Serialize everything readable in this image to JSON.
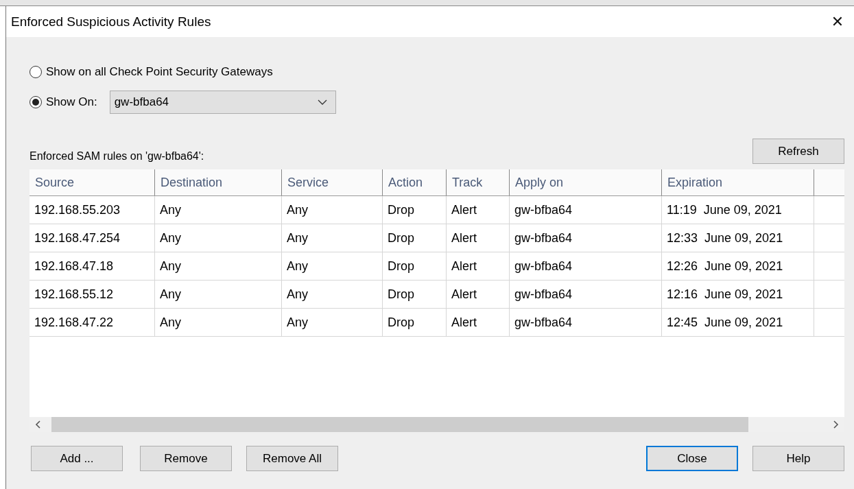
{
  "window": {
    "title": "Enforced Suspicious Activity Rules",
    "close": "✕"
  },
  "scope": [
    {
      "label": "Show on all Check Point Security Gateways",
      "selected": false
    },
    {
      "label": "Show On:",
      "selected": true
    }
  ],
  "gateway_select": {
    "value": "gw-bfba64"
  },
  "rules_label": "Enforced SAM rules on 'gw-bfba64':",
  "refresh_button": "Refresh",
  "table": {
    "columns": [
      "Source",
      "Destination",
      "Service",
      "Action",
      "Track",
      "Apply on",
      "Expiration"
    ],
    "rows": [
      [
        "192.168.55.203",
        "Any",
        "Any",
        "Drop",
        "Alert",
        "gw-bfba64",
        "11:19  June 09, 2021"
      ],
      [
        "192.168.47.254",
        "Any",
        "Any",
        "Drop",
        "Alert",
        "gw-bfba64",
        "12:33  June 09, 2021"
      ],
      [
        "192.168.47.18",
        "Any",
        "Any",
        "Drop",
        "Alert",
        "gw-bfba64",
        "12:26  June 09, 2021"
      ],
      [
        "192.168.55.12",
        "Any",
        "Any",
        "Drop",
        "Alert",
        "gw-bfba64",
        "12:16  June 09, 2021"
      ],
      [
        "192.168.47.22",
        "Any",
        "Any",
        "Drop",
        "Alert",
        "gw-bfba64",
        "12:45  June 09, 2021"
      ]
    ]
  },
  "left_buttons": [
    {
      "label": "Add ...",
      "default": false
    },
    {
      "label": "Remove",
      "default": false
    },
    {
      "label": "Remove All",
      "default": false
    }
  ],
  "right_buttons": [
    {
      "label": "Close",
      "default": true
    },
    {
      "label": "Help",
      "default": false
    }
  ]
}
